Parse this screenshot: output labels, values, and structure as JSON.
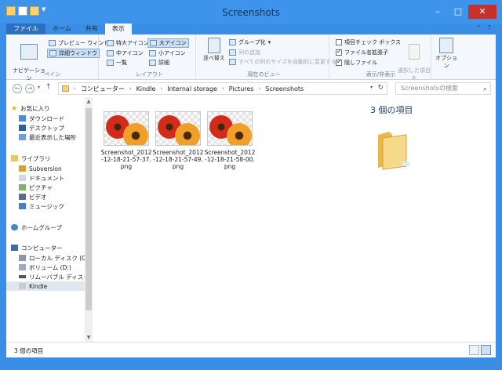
{
  "window": {
    "title": "Screenshots",
    "buttons": {
      "minimize": "–",
      "maximize": "□",
      "close": "✕"
    }
  },
  "ribbon": {
    "tabs": [
      {
        "label": "ファイル"
      },
      {
        "label": "ホーム"
      },
      {
        "label": "共有"
      },
      {
        "label": "表示"
      }
    ],
    "pane_group": {
      "nav_pane": "ナビゲーション\nウィンドウ",
      "preview_pane": "プレビュー ウィンドウ",
      "details_pane": "詳細ウィンドウ",
      "label": "ペイン"
    },
    "layout_group": {
      "items": [
        "特大アイコン",
        "大アイコン",
        "中アイコン",
        "小アイコン",
        "一覧",
        "詳細"
      ],
      "label": "レイアウト"
    },
    "view_group": {
      "sort": "並べ替え",
      "group_by": "グループ化",
      "add_column": "列の追加",
      "fit_columns": "すべての列のサイズを自動的に変更する",
      "label": "現在のビュー"
    },
    "show_group": {
      "item_checkboxes": "項目チェック ボックス",
      "file_ext": "ファイル名拡張子",
      "hidden_files": "隠しファイル",
      "hide_selected": "選択した項目を\n表示しない",
      "options": "オプション",
      "label": "表示/非表示"
    }
  },
  "address": {
    "crumbs": [
      "コンピューター",
      "Kindle",
      "Internal storage",
      "Pictures",
      "Screenshots"
    ],
    "search_placeholder": "Screenshotsの検索"
  },
  "nav": {
    "favorites": "お気に入り",
    "downloads": "ダウンロード",
    "desktop": "デスクトップ",
    "recent": "最近表示した場所",
    "libraries": "ライブラリ",
    "subversion": "Subversion",
    "documents": "ドキュメント",
    "pictures": "ピクチャ",
    "videos": "ビデオ",
    "music": "ミュージック",
    "homegroup": "ホームグループ",
    "computer": "コンピューター",
    "local_disk": "ローカル ディスク (C:)",
    "volume_d": "ボリューム (D:)",
    "removable": "リムーバブル ディスク (",
    "kindle": "Kindle"
  },
  "files": [
    {
      "name": "Screenshot_2012-12-18-21-57-37.png"
    },
    {
      "name": "Screenshot_2012-12-18-21-57-49.png"
    },
    {
      "name": "Screenshot_2012-12-18-21-58-00.png"
    }
  ],
  "preview": {
    "count": "3 個の項目"
  },
  "status": {
    "text": "3 個の項目"
  },
  "colors": {
    "titlebar": "#3e93ea",
    "file_tab": "#2d6fc0",
    "close": "#c7312a"
  }
}
